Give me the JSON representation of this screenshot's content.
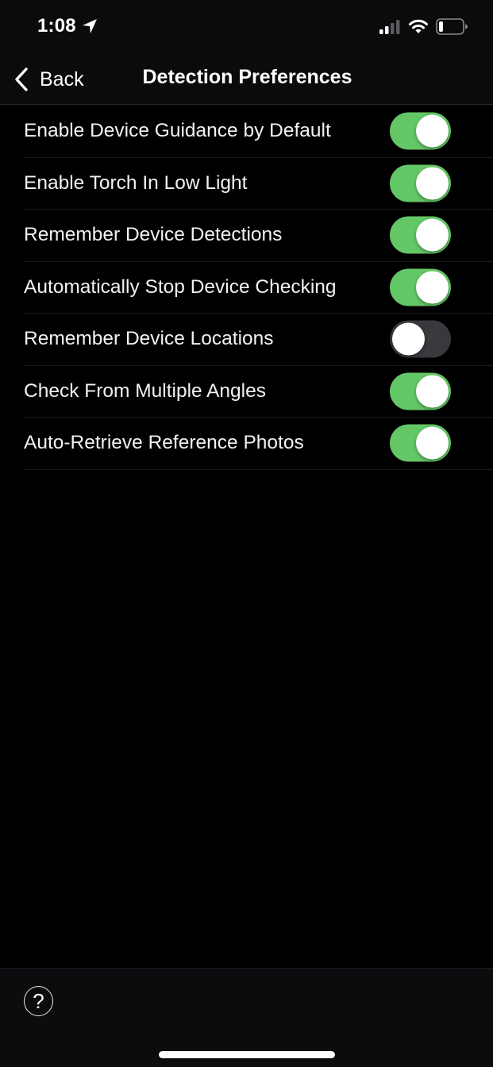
{
  "status_bar": {
    "time": "1:08",
    "icons": [
      "location-arrow-icon",
      "cellular-signal-icon",
      "wifi-icon",
      "battery-icon"
    ],
    "battery_level": "low"
  },
  "nav": {
    "back_label": "Back",
    "title": "Detection Preferences"
  },
  "settings": [
    {
      "label": "Enable Device Guidance by Default",
      "enabled": true
    },
    {
      "label": "Enable Torch In Low Light",
      "enabled": true
    },
    {
      "label": "Remember Device Detections",
      "enabled": true
    },
    {
      "label": "Automatically Stop Device Checking",
      "enabled": true
    },
    {
      "label": "Remember Device Locations",
      "enabled": false
    },
    {
      "label": "Check From Multiple Angles",
      "enabled": true
    },
    {
      "label": "Auto-Retrieve Reference Photos",
      "enabled": true
    }
  ],
  "footer": {
    "help_label": "?"
  },
  "colors": {
    "toggle_on": "#64c766",
    "toggle_off": "#39393d",
    "background": "#000000"
  }
}
